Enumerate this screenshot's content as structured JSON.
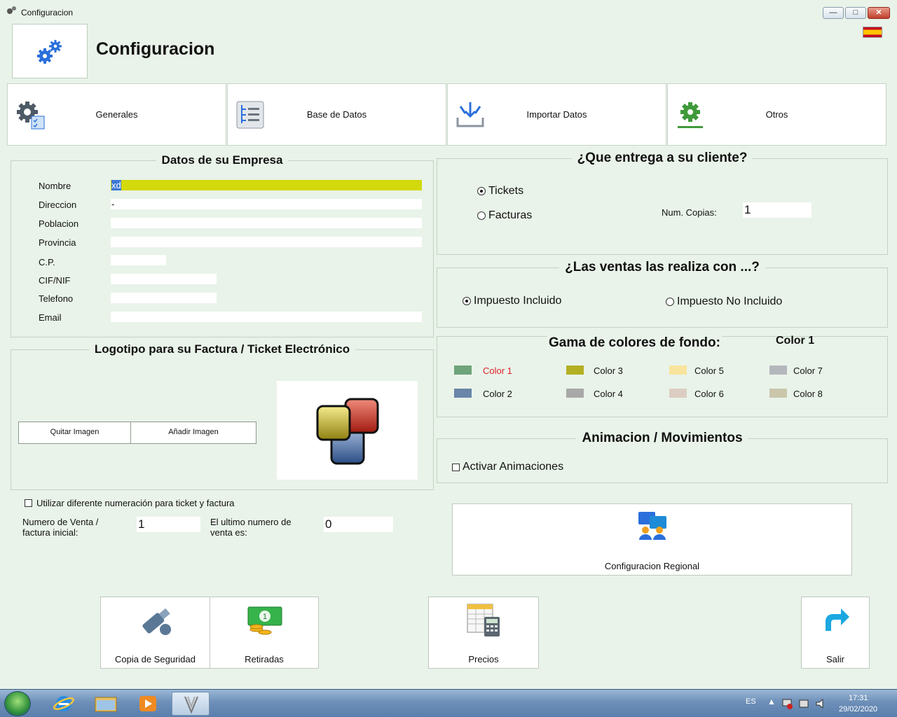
{
  "window": {
    "title": "Configuracion",
    "minimize": "—",
    "maximize": "□",
    "close": "✕"
  },
  "header": {
    "title": "Configuracion",
    "icon": "gears-icon",
    "language_flag": "spain-flag"
  },
  "tabs": [
    {
      "label": "Generales",
      "icon": "gear-checklist-icon"
    },
    {
      "label": "Base de Datos",
      "icon": "database-tree-icon"
    },
    {
      "label": "Importar Datos",
      "icon": "import-tray-icon"
    },
    {
      "label": "Otros",
      "icon": "green-gear-icon"
    }
  ],
  "empresa": {
    "legend": "Datos de su Empresa",
    "fields": [
      {
        "label": "Nombre",
        "value": "xd"
      },
      {
        "label": "Direccion",
        "value": "-"
      },
      {
        "label": "Poblacion",
        "value": ""
      },
      {
        "label": "Provincia",
        "value": ""
      },
      {
        "label": "C.P.",
        "value": ""
      },
      {
        "label": "CIF/NIF",
        "value": ""
      },
      {
        "label": "Telefono",
        "value": ""
      },
      {
        "label": "Email",
        "value": ""
      }
    ]
  },
  "logotipo": {
    "legend": "Logotipo para su Factura / Ticket Electrónico",
    "remove_label": "Quitar Imagen",
    "add_label": "Añadir Imagen"
  },
  "numeracion": {
    "checkbox_label": "Utilizar diferente numeración para ticket y factura",
    "checked": false,
    "initial_label_1": "Numero de Venta /",
    "initial_label_2": "factura inicial:",
    "initial_value": "1",
    "last_label_1": "El ultimo numero de",
    "last_label_2": "venta es:",
    "last_value": "0"
  },
  "entrega": {
    "legend": "¿Que entrega a su cliente?",
    "options": [
      "Tickets",
      "Facturas"
    ],
    "selected": "Tickets",
    "copies_label": "Num. Copias:",
    "copies_value": "1"
  },
  "ventas": {
    "legend": "¿Las ventas las realiza con ...?",
    "options": [
      "Impuesto Incluido",
      "Impuesto No Incluido"
    ],
    "selected": "Impuesto Incluido"
  },
  "colores": {
    "legend": "Gama de colores de fondo:",
    "selected_label": "Color 1",
    "items": [
      {
        "label": "Color 1",
        "color": "#6fa37a",
        "selected": true
      },
      {
        "label": "Color 2",
        "color": "#6a86a8"
      },
      {
        "label": "Color 3",
        "color": "#b3b024"
      },
      {
        "label": "Color 4",
        "color": "#a8a8a8"
      },
      {
        "label": "Color 5",
        "color": "#f8e49c"
      },
      {
        "label": "Color 6",
        "color": "#dccdc2"
      },
      {
        "label": "Color 7",
        "color": "#b4b8bd"
      },
      {
        "label": "Color 8",
        "color": "#cac6ac"
      }
    ]
  },
  "animacion": {
    "legend": "Animacion / Movimientos",
    "checkbox_label": "Activar Animaciones",
    "checked": false
  },
  "regional": {
    "label": "Configuracion Regional",
    "icon": "regional-people-icon"
  },
  "bottom_buttons": [
    {
      "label": "Copia de Seguridad",
      "icon": "usb-drive-icon"
    },
    {
      "label": "Retiradas",
      "icon": "cash-coins-icon"
    },
    {
      "label": "Precios",
      "icon": "price-calculator-icon"
    },
    {
      "label": "Salir",
      "icon": "exit-arrow-icon"
    }
  ],
  "taskbar": {
    "language": "ES",
    "time": "17:31",
    "date": "29/02/2020",
    "apps": [
      "internet-explorer-icon",
      "file-explorer-icon",
      "media-player-icon",
      "app-icon"
    ]
  },
  "colors": {
    "background": "#e9f3e9",
    "accent_blue": "#2a6fdb",
    "selected_color_label": "#e0202a"
  }
}
